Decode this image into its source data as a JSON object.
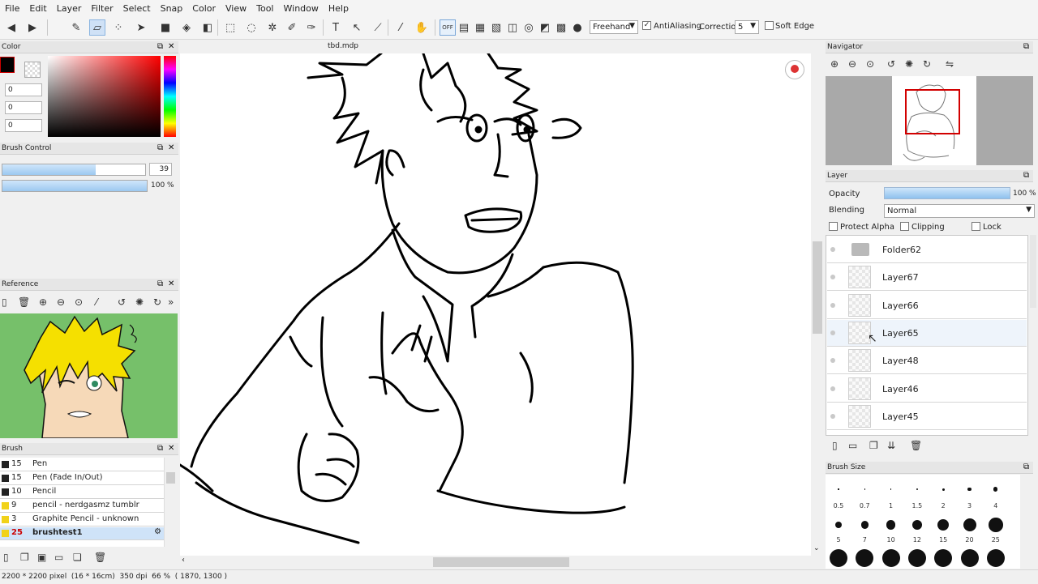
{
  "menu": [
    "File",
    "Edit",
    "Layer",
    "Filter",
    "Select",
    "Snap",
    "Color",
    "View",
    "Tool",
    "Window",
    "Help"
  ],
  "toolbar": {
    "stroke_mode": "Freehand",
    "antialiasing_label": "AntiAliasing",
    "antialiasing_checked": true,
    "correction_label": "Correction",
    "correction_value": "5",
    "soft_edge_label": "Soft Edge",
    "snap_off_label": "OFF"
  },
  "color_panel": {
    "title": "Color",
    "r": "0",
    "g": "0",
    "b": "0",
    "fg": "#000000"
  },
  "brush_control": {
    "title": "Brush Control",
    "size_fraction": 0.655,
    "size": "39",
    "opacity_fraction": 1.0,
    "opacity": "100 %"
  },
  "reference": {
    "title": "Reference"
  },
  "brush_panel": {
    "title": "Brush",
    "items": [
      {
        "size": "15",
        "name": "Pen",
        "color": "#222222"
      },
      {
        "size": "15",
        "name": "Pen (Fade In/Out)",
        "color": "#222222"
      },
      {
        "size": "10",
        "name": "Pencil",
        "color": "#222222"
      },
      {
        "size": "9",
        "name": "pencil - nerdgasmz tumblr",
        "color": "#f1d21a"
      },
      {
        "size": "3",
        "name": "Graphite Pencil - unknown",
        "color": "#f1d21a"
      },
      {
        "size": "25",
        "name": "brushtest1",
        "color": "#f1d21a",
        "selected": true
      }
    ]
  },
  "canvas": {
    "tab_title": "tbd.mdp"
  },
  "status": {
    "text": "2200 * 2200 pixel  (16 * 16cm)  350 dpi  66 %  ( 1870, 1300 )"
  },
  "navigator": {
    "title": "Navigator"
  },
  "layer_panel": {
    "title": "Layer",
    "opacity_label": "Opacity",
    "opacity_value": "100 %",
    "opacity_fraction": 1.0,
    "blending_label": "Blending",
    "blending_value": "Normal",
    "protect_alpha": "Protect Alpha",
    "clipping": "Clipping",
    "lock": "Lock",
    "layers": [
      "Folder62",
      "Layer67",
      "Layer66",
      "Layer65",
      "Layer48",
      "Layer46",
      "Layer45"
    ]
  },
  "brush_size": {
    "title": "Brush Size",
    "row1": [
      "0.5",
      "0.7",
      "1",
      "1.5",
      "2",
      "3",
      "4"
    ],
    "row2": [
      "5",
      "7",
      "10",
      "12",
      "15",
      "20",
      "25"
    ]
  },
  "icons": [
    "pen-icon",
    "eraser-icon",
    "folder-icon",
    "trash-icon",
    "zoom-in-icon",
    "zoom-out-icon",
    "rotate-icon",
    "hand-icon",
    "eyedropper-icon",
    "text-icon"
  ]
}
